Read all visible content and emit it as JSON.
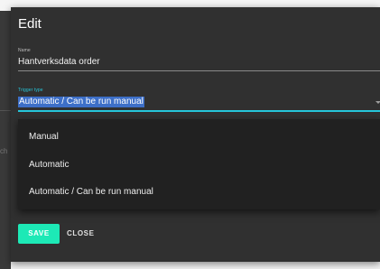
{
  "dialog": {
    "title": "Edit",
    "name_field": {
      "label": "Name",
      "value": "Hantverksdata order"
    },
    "trigger_field": {
      "label": "Trigger type",
      "value": "Automatic / Can be run manual",
      "options": [
        "Manual",
        "Automatic",
        "Automatic / Can be run manual"
      ]
    },
    "buttons": {
      "save": "SAVE",
      "close": "CLOSE"
    }
  },
  "background": {
    "partial_text": "ch"
  },
  "colors": {
    "accent": "#26c6da",
    "save_button": "#1de9b6",
    "dialog_bg": "#303030",
    "menu_bg": "#212121",
    "selection": "#3d6fc8"
  }
}
